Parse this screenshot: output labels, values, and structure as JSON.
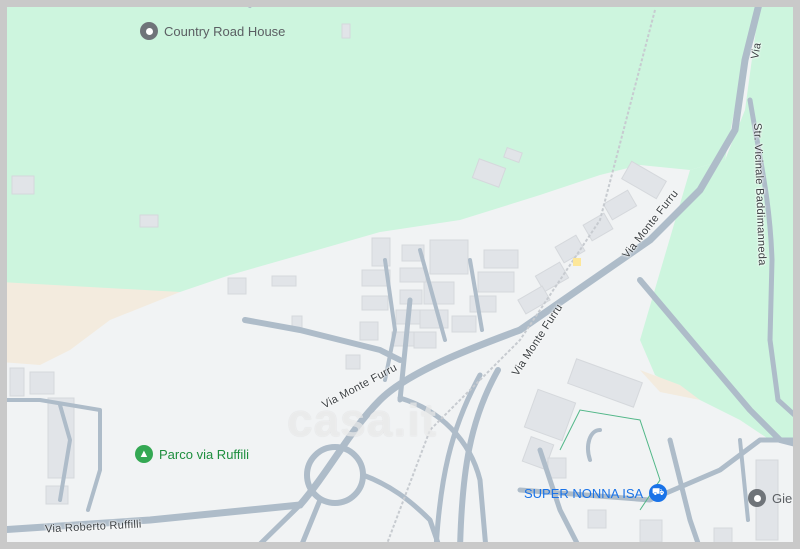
{
  "colors": {
    "park": "#cdf5de",
    "land": "#f1f3f4",
    "sand": "#f6ede0",
    "road": "#aebcc9",
    "building": "#e2e4e7",
    "poi_grey": "#6f7479",
    "poi_park": "#1e8e3e",
    "poi_shop": "#1a73e8"
  },
  "pois": {
    "country_road_house": {
      "label": "Country Road House",
      "icon": "place-pin-icon"
    },
    "parco": {
      "label": "Parco via Ruffili",
      "icon": "tree-icon"
    },
    "super_nonna": {
      "label": "SUPER NONNA ISA",
      "icon": "shopping-cart-icon"
    },
    "gie": {
      "label": "Gie",
      "icon": "place-pin-icon"
    }
  },
  "roads": {
    "monte_furru_upper": "Via Monte Furru",
    "monte_furru_lower": "Via Monte Furru",
    "monte_furru_left": "Via Monte Furru",
    "roberto_ruffilli": "Via Roberto Ruffilli",
    "via_top_right": "Via",
    "baddimanneda": "Str. Vicinale Baddimanneda"
  },
  "watermark": "casa.it"
}
